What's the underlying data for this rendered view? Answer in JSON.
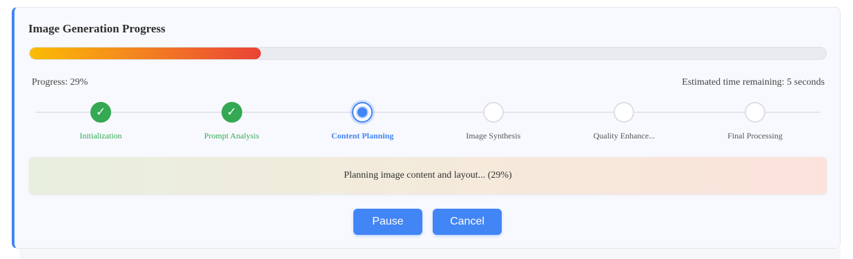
{
  "panel": {
    "title": "Image Generation Progress",
    "progress_fraction": 0.29,
    "progress_label": "Progress: 29%",
    "eta_label": "Estimated time remaining: 5 seconds",
    "status_message": "Planning image content and layout... (29%)"
  },
  "steps": [
    {
      "label": "Initialization",
      "state": "done"
    },
    {
      "label": "Prompt Analysis",
      "state": "done"
    },
    {
      "label": "Content Planning",
      "state": "active"
    },
    {
      "label": "Image Synthesis",
      "state": "pending"
    },
    {
      "label": "Quality Enhance...",
      "state": "pending"
    },
    {
      "label": "Final Processing",
      "state": "pending"
    }
  ],
  "step_done_glyph": "✓",
  "icons": {
    "done": "checkmark-icon",
    "active": "active-dot-icon"
  },
  "buttons": {
    "pause_label": "Pause",
    "cancel_label": "Cancel"
  },
  "colors": {
    "accent": "#4285f4",
    "success": "#34a853",
    "bar_start": "#fbbc04",
    "bar_end": "#ea4335"
  }
}
